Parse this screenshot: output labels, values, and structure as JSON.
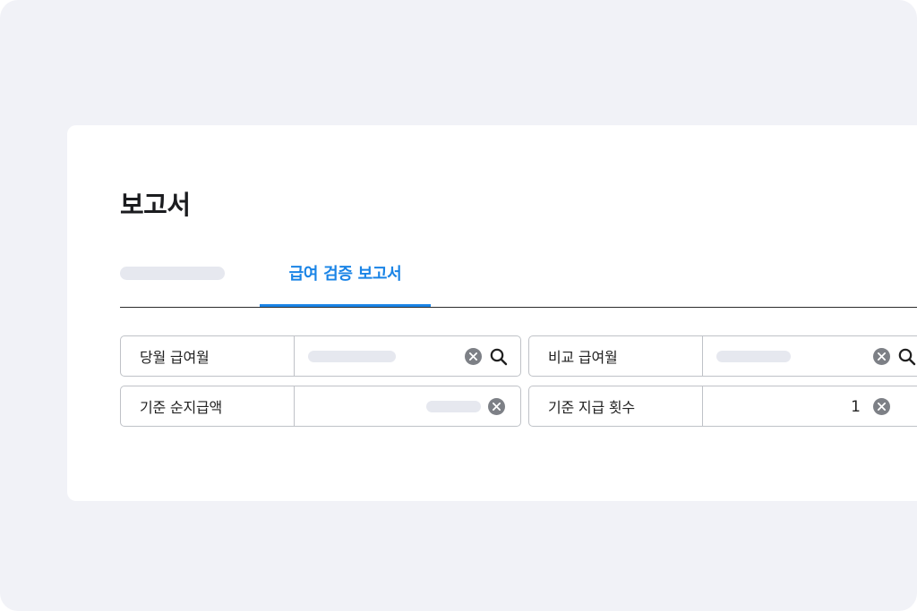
{
  "page": {
    "title": "보고서"
  },
  "tabs": [
    {
      "label": ""
    },
    {
      "label": "급여 검증 보고서",
      "active": true
    }
  ],
  "filters": [
    {
      "label": "당월 급여월",
      "value": ""
    },
    {
      "label": "비교 급여월",
      "value": ""
    },
    {
      "label": "기준 순지급액",
      "value": ""
    },
    {
      "label": "기준 지급 횟수",
      "value": "1"
    }
  ],
  "colors": {
    "background": "#f1f2f7",
    "accent": "#1a84e6",
    "clear_icon": "#7d8086",
    "placeholder": "#e6e8ef"
  },
  "icons": {
    "clear": "clear-circle-icon",
    "search": "search-icon"
  }
}
